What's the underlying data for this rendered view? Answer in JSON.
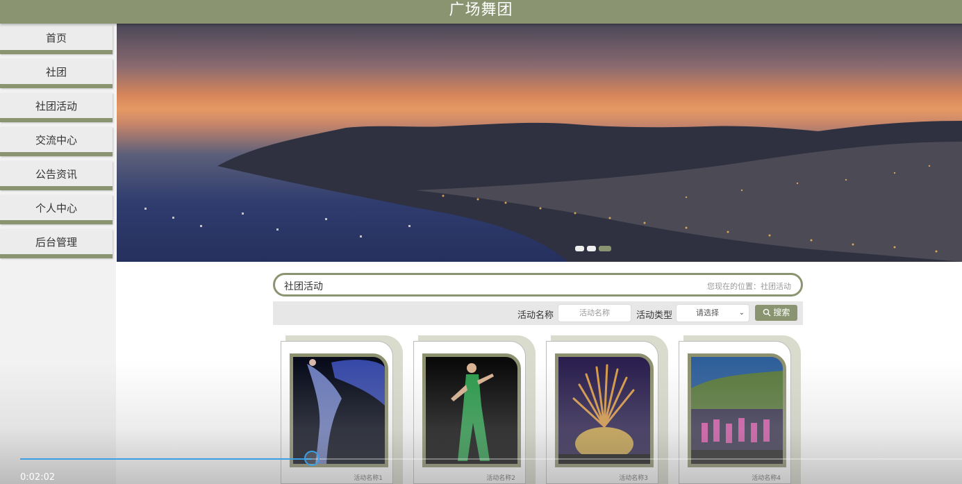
{
  "header": {
    "title": "广场舞团"
  },
  "sidebar": {
    "items": [
      {
        "label": "首页"
      },
      {
        "label": "社团"
      },
      {
        "label": "社团活动"
      },
      {
        "label": "交流中心"
      },
      {
        "label": "公告资讯"
      },
      {
        "label": "个人中心"
      },
      {
        "label": "后台管理"
      }
    ]
  },
  "banner": {
    "slide_count": 3,
    "active_slide": 3
  },
  "section": {
    "title": "社团活动",
    "location": "您现在的位置：社团活动"
  },
  "filter": {
    "name_label": "活动名称",
    "name_placeholder": "活动名称",
    "type_label": "活动类型",
    "type_selected": "请选择",
    "search_label": "搜索"
  },
  "cards": [
    {
      "name": "活动名称1"
    },
    {
      "name": "活动名称2"
    },
    {
      "name": "活动名称3"
    },
    {
      "name": "活动名称4"
    }
  ],
  "video": {
    "elapsed": "0:02:02",
    "progress": 0.31
  },
  "colors": {
    "accent": "#8a9470",
    "progress": "#3aa0e6"
  }
}
